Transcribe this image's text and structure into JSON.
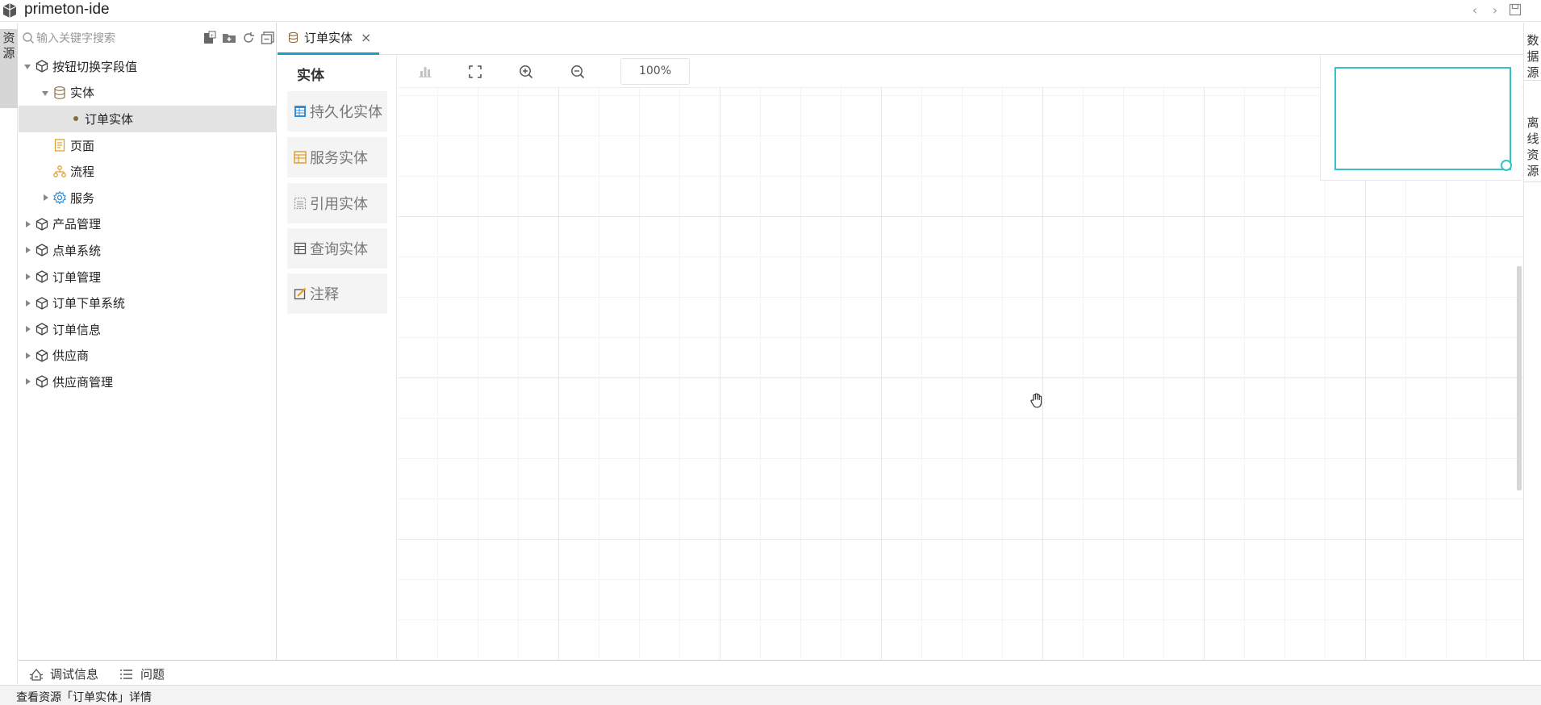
{
  "app": {
    "title": "primeton-ide"
  },
  "left_rail": {
    "tab_label": "资源"
  },
  "explorer": {
    "search_placeholder": "输入关键字搜索",
    "tree": [
      {
        "label": "按钮切换字段值",
        "level": 0,
        "expanded": true,
        "icon": "package-icon"
      },
      {
        "label": "实体",
        "level": 1,
        "expanded": true,
        "icon": "database-icon"
      },
      {
        "label": "订单实体",
        "level": 2,
        "selected": true,
        "icon": "dot"
      },
      {
        "label": "页面",
        "level": 1,
        "icon": "page-icon"
      },
      {
        "label": "流程",
        "level": 1,
        "icon": "flow-icon"
      },
      {
        "label": "服务",
        "level": 1,
        "expanded": false,
        "icon": "gear-icon"
      },
      {
        "label": "产品管理",
        "level": 0,
        "expanded": false,
        "icon": "package-icon"
      },
      {
        "label": "点单系统",
        "level": 0,
        "expanded": false,
        "icon": "package-icon"
      },
      {
        "label": "订单管理",
        "level": 0,
        "expanded": false,
        "icon": "package-icon"
      },
      {
        "label": "订单下单系统",
        "level": 0,
        "expanded": false,
        "icon": "package-icon"
      },
      {
        "label": "订单信息",
        "level": 0,
        "expanded": false,
        "icon": "package-icon"
      },
      {
        "label": "供应商",
        "level": 0,
        "expanded": false,
        "icon": "package-icon"
      },
      {
        "label": "供应商管理",
        "level": 0,
        "expanded": false,
        "icon": "package-icon"
      }
    ]
  },
  "editor": {
    "tab": {
      "label": "订单实体",
      "close": "×"
    },
    "palette": {
      "title": "实体",
      "items": [
        "持久化实体",
        "服务实体",
        "引用实体",
        "查询实体",
        "注释"
      ]
    },
    "toolbar": {
      "zoom": "100%"
    }
  },
  "right_rail": {
    "tabs": [
      "数据源",
      "离线资源"
    ]
  },
  "bottom_panel": {
    "items": [
      "调试信息",
      "问题"
    ]
  },
  "status": {
    "text": "查看资源「订单实体」详情"
  },
  "colors": {
    "accent": "#16a0c7",
    "minimap": "#35c3c7"
  }
}
